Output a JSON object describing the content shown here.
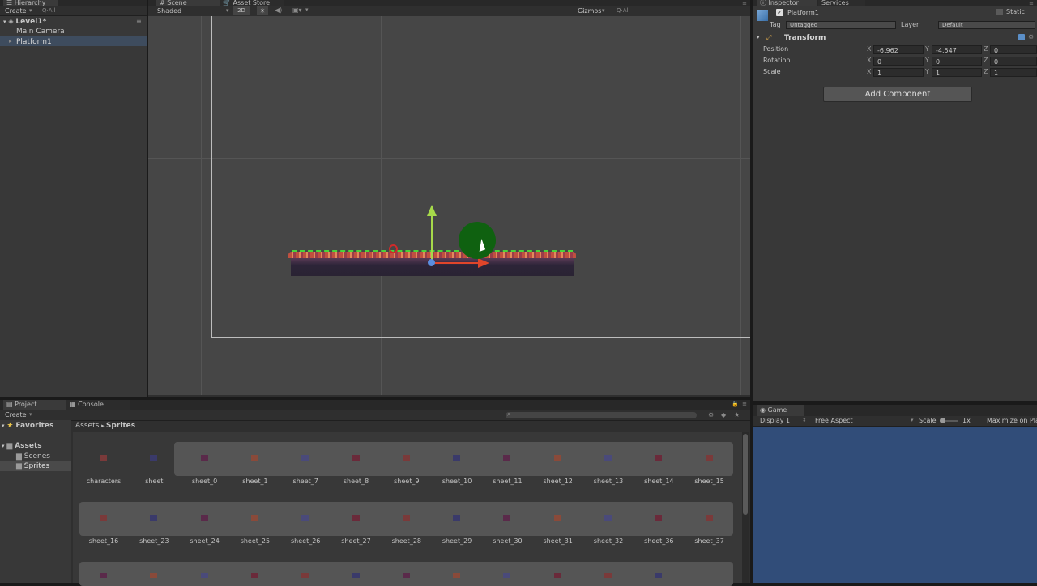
{
  "hierarchy": {
    "tab": "Hierarchy",
    "create": "Create",
    "search_placeholder": "Q·All",
    "scene_name": "Level1*",
    "items": [
      "Main Camera",
      "Platform1"
    ]
  },
  "scene": {
    "tabs": [
      "Scene",
      "Asset Store"
    ],
    "shading": "Shaded",
    "mode_2d": "2D",
    "gizmos": "Gizmos",
    "search_placeholder": "Q·All"
  },
  "inspector": {
    "tabs": [
      "Inspector",
      "Services"
    ],
    "object_name": "Platform1",
    "static_label": "Static",
    "tag_label": "Tag",
    "tag_value": "Untagged",
    "layer_label": "Layer",
    "layer_value": "Default",
    "component": "Transform",
    "rows": [
      {
        "label": "Position",
        "x": "-6.962",
        "y": "-4.547",
        "z": "0"
      },
      {
        "label": "Rotation",
        "x": "0",
        "y": "0",
        "z": "0"
      },
      {
        "label": "Scale",
        "x": "1",
        "y": "1",
        "z": "1"
      }
    ],
    "axis_labels": [
      "X",
      "Y",
      "Z"
    ],
    "add_component": "Add Component"
  },
  "project": {
    "tabs": [
      "Project",
      "Console"
    ],
    "create": "Create",
    "favorites": "Favorites",
    "assets": "Assets",
    "folders": [
      "Scenes",
      "Sprites"
    ],
    "breadcrumb": [
      "Assets",
      "Sprites"
    ],
    "row1": [
      "characters",
      "sheet",
      "sheet_0",
      "sheet_1",
      "sheet_7",
      "sheet_8",
      "sheet_9",
      "sheet_10",
      "sheet_11",
      "sheet_12",
      "sheet_13",
      "sheet_14",
      "sheet_15"
    ],
    "row2": [
      "sheet_16",
      "sheet_23",
      "sheet_24",
      "sheet_25",
      "sheet_26",
      "sheet_27",
      "sheet_28",
      "sheet_29",
      "sheet_30",
      "sheet_31",
      "sheet_32",
      "sheet_36",
      "sheet_37"
    ]
  },
  "game": {
    "tab": "Game",
    "display": "Display 1",
    "aspect": "Free Aspect",
    "scale_label": "Scale",
    "scale_value": "1x",
    "maximize": "Maximize on Play",
    "background_color": "#314d79"
  }
}
